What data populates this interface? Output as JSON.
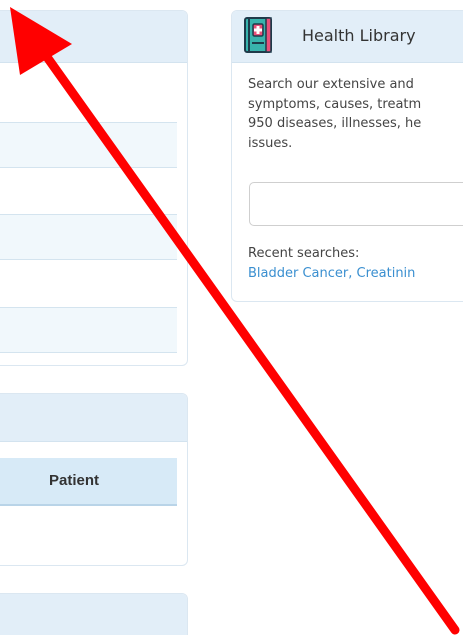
{
  "left_panels": {
    "table_header": {
      "patient": "Patient"
    }
  },
  "health_library": {
    "title": "Health Library",
    "icon": "medical-book-icon",
    "description_lines": [
      "Search our extensive and",
      "symptoms, causes, treatm",
      "950 diseases, illnesses, he",
      "issues."
    ],
    "search": {
      "value": "",
      "placeholder": ""
    },
    "recent_label": "Recent searches:",
    "recent_links": "Bladder Cancer, Creatinin"
  },
  "annotation": {
    "icon": "red-arrow-icon",
    "color": "#ff0000"
  },
  "colors": {
    "panel_header": "#e2eef8",
    "row_stripe": "#f1f8fc",
    "table_header": "#d7eaf7",
    "link": "#3a8fd0",
    "icon_teal": "#38b3ad",
    "icon_pink": "#e9507a"
  }
}
